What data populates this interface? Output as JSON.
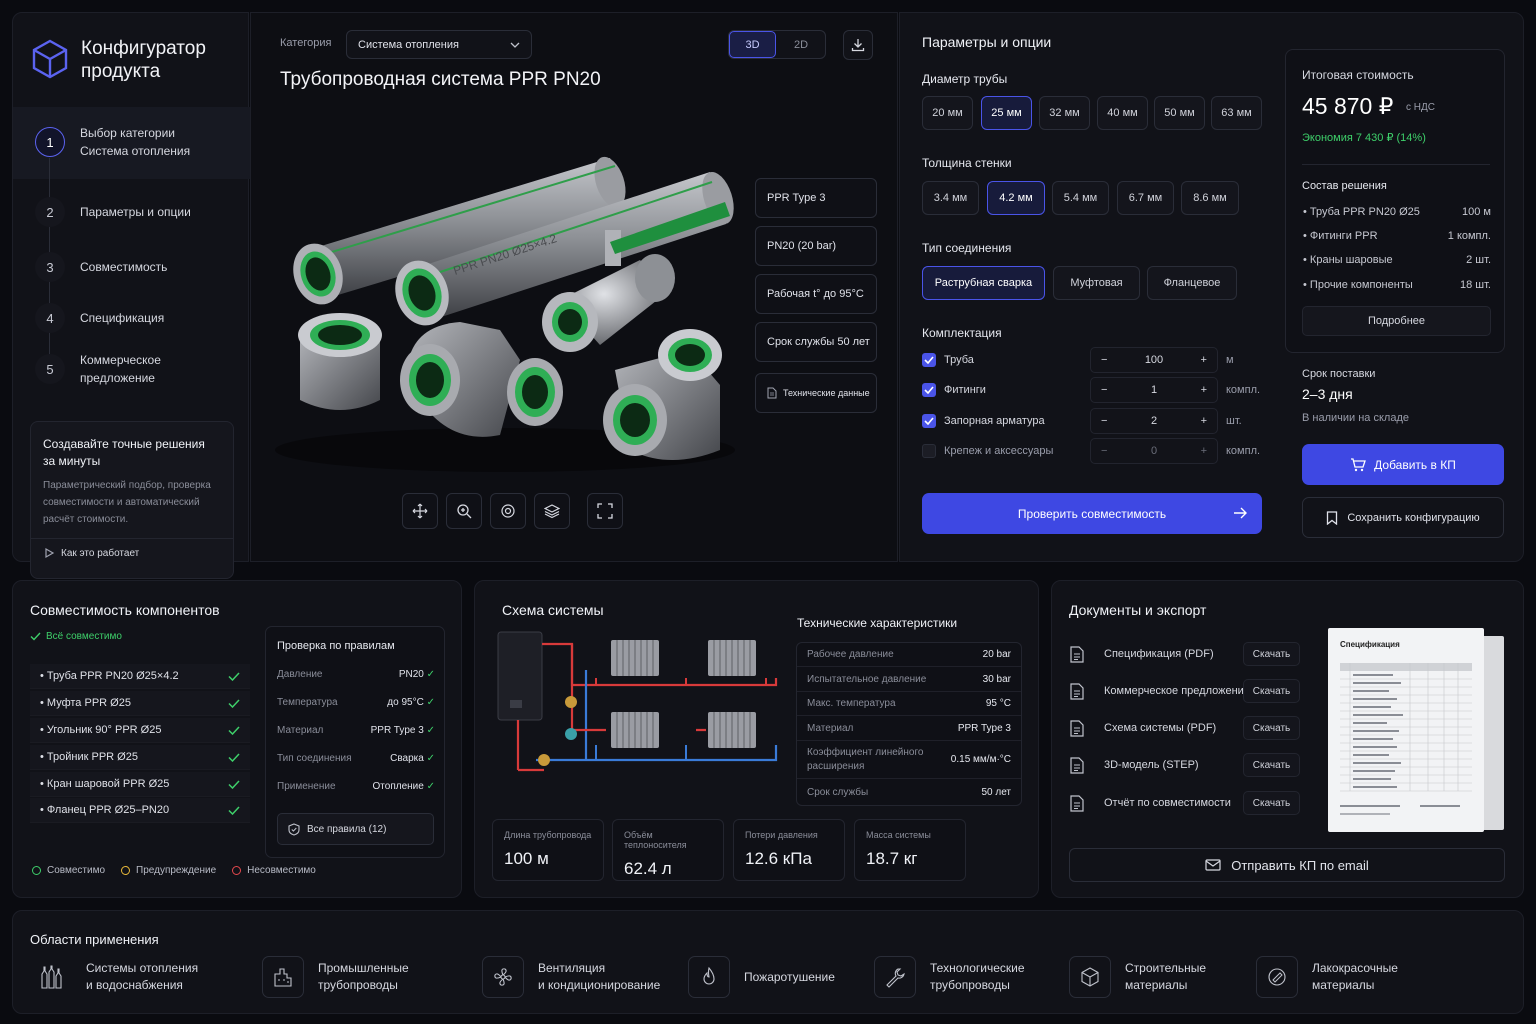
{
  "app": {
    "title_line1": "Конфигуратор",
    "title_line2": "продукта"
  },
  "steps": [
    {
      "num": "1",
      "label": "Выбор категории",
      "sub": "Система отопления"
    },
    {
      "num": "2",
      "label": "Параметры и опции"
    },
    {
      "num": "3",
      "label": "Совместимость"
    },
    {
      "num": "4",
      "label": "Спецификация"
    },
    {
      "num": "5",
      "label": "Коммерческое предложение"
    }
  ],
  "promo": {
    "title_line1": "Создавайте точные решения",
    "title_line2": "за минуты",
    "text_line1": "Параметрический подбор, проверка",
    "text_line2": "совместимости и автоматический",
    "text_line3": "расчёт стоимости.",
    "link": "Как это работает"
  },
  "viewer": {
    "category_label": "Категория",
    "category_value": "Система отопления",
    "toggle_3d": "3D",
    "toggle_2d": "2D",
    "title": "Трубопроводная система PPR PN20",
    "pipe_text": "PPR PN20 Ø25×4.2",
    "tags": [
      "PPR Type 3",
      "PN20 (20 bar)",
      "Рабочая t° до 95°C",
      "Срок службы 50 лет"
    ],
    "tech_data": "Технические данные"
  },
  "params": {
    "title": "Параметры и опции",
    "diameter_label": "Диаметр трубы",
    "diameters": [
      "20 мм",
      "25 мм",
      "32 мм",
      "40 мм",
      "50 мм",
      "63 мм"
    ],
    "diameter_selected": "25 мм",
    "wall_label": "Толщина стенки",
    "walls": [
      "3.4 мм",
      "4.2 мм",
      "5.4 мм",
      "6.7 мм",
      "8.6 мм"
    ],
    "wall_selected": "4.2 мм",
    "connection_label": "Тип соединения",
    "connections": [
      "Раструбная сварка",
      "Муфтовая",
      "Фланцевое"
    ],
    "connection_selected": "Раструбная сварка",
    "kit_label": "Комплектация",
    "kit": [
      {
        "name": "Труба",
        "checked": true,
        "qty": "100",
        "unit": "м"
      },
      {
        "name": "Фитинги",
        "checked": true,
        "qty": "1",
        "unit": "компл."
      },
      {
        "name": "Запорная арматура",
        "checked": true,
        "qty": "2",
        "unit": "шт."
      },
      {
        "name": "Крепеж и аксессуары",
        "checked": false,
        "qty": "0",
        "unit": "компл."
      }
    ],
    "check_button": "Проверить совместимость"
  },
  "summary": {
    "total_label": "Итоговая стоимость",
    "total": "45 870 ₽",
    "vat": "с НДС",
    "savings": "Экономия 7 430 ₽ (14%)",
    "composition_label": "Состав решения",
    "items": [
      {
        "name": "Труба PPR PN20 Ø25",
        "qty": "100 м"
      },
      {
        "name": "Фитинги PPR",
        "qty": "1 компл."
      },
      {
        "name": "Краны шаровые",
        "qty": "2 шт."
      },
      {
        "name": "Прочие компоненты",
        "qty": "18 шт."
      }
    ],
    "more_button": "Подробнее",
    "delivery_label": "Срок поставки",
    "delivery_value": "2–3 дня",
    "stock": "В наличии на складе",
    "add_button": "Добавить в КП",
    "save_button": "Сохранить конфигурацию"
  },
  "compat": {
    "title": "Совместимость компонентов",
    "status": "Всё совместимо",
    "items": [
      "Труба PPR PN20 Ø25×4.2",
      "Муфта PPR Ø25",
      "Угольник 90° PPR Ø25",
      "Тройник PPR Ø25",
      "Кран шаровой PPR Ø25",
      "Фланец PPR Ø25–PN20"
    ],
    "rules_title": "Проверка по правилам",
    "rules": [
      {
        "k": "Давление",
        "v": "PN20"
      },
      {
        "k": "Температура",
        "v": "до 95°C"
      },
      {
        "k": "Материал",
        "v": "PPR Type 3"
      },
      {
        "k": "Тип соединения",
        "v": "Сварка"
      },
      {
        "k": "Применение",
        "v": "Отопление"
      }
    ],
    "all_rules": "Все правила (12)",
    "legend": [
      "Совместимо",
      "Предупреждение",
      "Несовместимо"
    ],
    "legend_colors": [
      "#3ecf6a",
      "#e8b93a",
      "#e5484d"
    ]
  },
  "scheme": {
    "title": "Схема системы",
    "tech_title": "Технические характеристики",
    "tech": [
      {
        "k": "Рабочее давление",
        "v": "20 bar"
      },
      {
        "k": "Испытательное давление",
        "v": "30 bar"
      },
      {
        "k": "Макс. температура",
        "v": "95 °C"
      },
      {
        "k": "Материал",
        "v": "PPR Type 3"
      },
      {
        "k": "Коэффициент линейного",
        "k2": "расширения",
        "v": "0.15 мм/м·°C"
      },
      {
        "k": "Срок службы",
        "v": "50 лет"
      }
    ],
    "stats": [
      {
        "l": "Длина трубопровода",
        "v": "100 м"
      },
      {
        "l": "Объём теплоносителя",
        "v": "62.4 л"
      },
      {
        "l": "Потери давления",
        "v": "12.6 кПа"
      },
      {
        "l": "Масса системы",
        "v": "18.7 кг"
      }
    ]
  },
  "docs": {
    "title": "Документы и экспорт",
    "items": [
      "Спецификация (PDF)",
      "Коммерческое предложение",
      "Схема системы (PDF)",
      "3D-модель (STEP)",
      "Отчёт по совместимости"
    ],
    "download": "Скачать",
    "preview_title": "Спецификация",
    "email_button": "Отправить КП по email"
  },
  "apps": {
    "title": "Области применения",
    "items": [
      {
        "label": "Системы отопления\nи водоснабжения",
        "icon": "bottles-icon"
      },
      {
        "label": "Промышленные\nтрубопроводы",
        "icon": "factory-icon"
      },
      {
        "label": "Вентиляция\nи кондиционирование",
        "icon": "fan-icon"
      },
      {
        "label": "Пожаротушение",
        "icon": "flame-icon"
      },
      {
        "label": "Технологические\nтрубопроводы",
        "icon": "wrench-icon"
      },
      {
        "label": "Строительные\nматериалы",
        "icon": "cube-icon"
      },
      {
        "label": "Лакокрасочные\nматериалы",
        "icon": "paint-icon"
      }
    ]
  },
  "colors": {
    "accent": "#4a54e8",
    "success": "#3ecf6a",
    "panel": "#111218"
  }
}
